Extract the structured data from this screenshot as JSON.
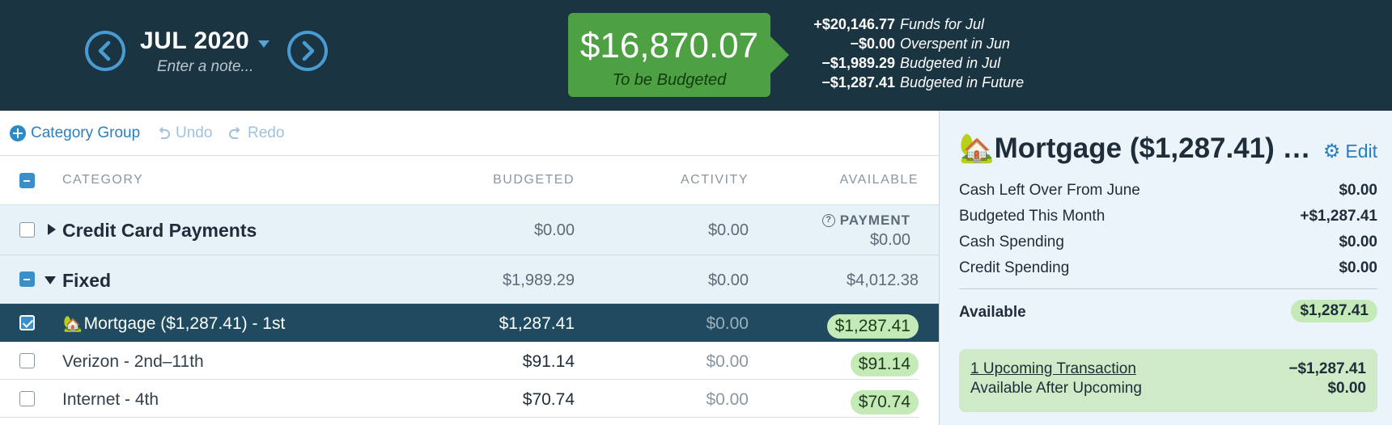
{
  "header": {
    "month": "JUL 2020",
    "note_placeholder": "Enter a note...",
    "to_be_budgeted": {
      "amount": "$16,870.07",
      "label": "To be Budgeted"
    },
    "funds": [
      {
        "amount": "+$20,146.77",
        "label": "Funds for Jul"
      },
      {
        "amount": "−$0.00",
        "label": "Overspent in Jun"
      },
      {
        "amount": "−$1,989.29",
        "label": "Budgeted in Jul"
      },
      {
        "amount": "−$1,287.41",
        "label": "Budgeted in Future"
      }
    ]
  },
  "toolbar": {
    "add_group": "Category Group",
    "undo": "Undo",
    "redo": "Redo"
  },
  "table": {
    "columns": {
      "category": "CATEGORY",
      "budgeted": "BUDGETED",
      "activity": "ACTIVITY",
      "available": "AVAILABLE"
    },
    "groups": [
      {
        "name": "Credit Card Payments",
        "budgeted": "$0.00",
        "activity": "$0.00",
        "available_label": "PAYMENT",
        "available": "$0.00"
      },
      {
        "name": "Fixed",
        "budgeted": "$1,989.29",
        "activity": "$0.00",
        "available": "$4,012.38",
        "categories": [
          {
            "name": "Mortgage ($1,287.41) - 1st",
            "budgeted": "$1,287.41",
            "activity": "$0.00",
            "available": "$1,287.41"
          },
          {
            "name": "Verizon - 2nd–11th",
            "budgeted": "$91.14",
            "activity": "$0.00",
            "available": "$91.14"
          },
          {
            "name": "Internet - 4th",
            "budgeted": "$70.74",
            "activity": "$0.00",
            "available": "$70.74"
          }
        ]
      }
    ]
  },
  "inspector": {
    "title": "Mortgage ($1,287.41) …",
    "edit_label": "Edit",
    "rows": [
      {
        "label": "Cash Left Over From June",
        "value": "$0.00"
      },
      {
        "label": "Budgeted This Month",
        "value": "+$1,287.41"
      },
      {
        "label": "Cash Spending",
        "value": "$0.00"
      },
      {
        "label": "Credit Spending",
        "value": "$0.00"
      }
    ],
    "available_label": "Available",
    "available_value": "$1,287.41",
    "upcoming": {
      "link": "1 Upcoming Transaction",
      "amount": "−$1,287.41",
      "after_label": "Available After Upcoming",
      "after_value": "$0.00"
    }
  },
  "colors": {
    "header_bg": "#1a3441",
    "accent_blue": "#2b7fbf",
    "tbb_green": "#4ea142",
    "available_pill": "#c3eab7",
    "selected_row": "#1f4a5f",
    "inspector_bg": "#eaf4fa"
  }
}
